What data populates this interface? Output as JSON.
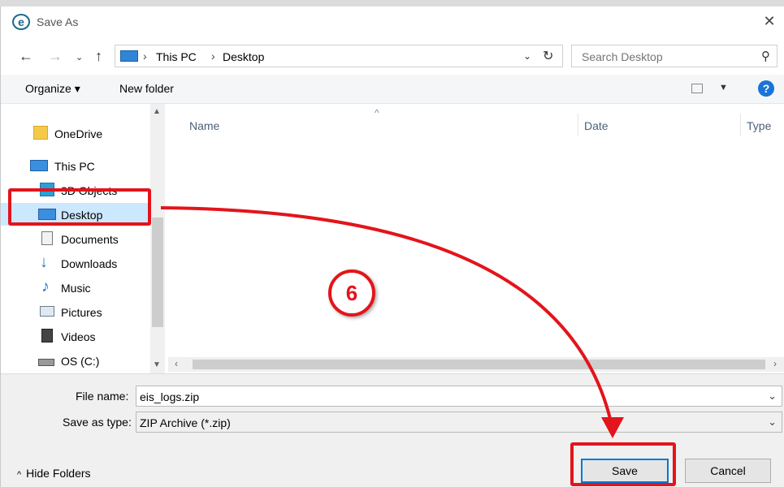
{
  "window": {
    "title": "Save As",
    "app_icon_glyph": "e"
  },
  "address_bar": {
    "crumbs": [
      "This PC",
      "Desktop"
    ],
    "search_placeholder": "Search Desktop"
  },
  "toolbar": {
    "organize": "Organize ▾",
    "new_folder": "New folder"
  },
  "nav_pane": {
    "items": [
      {
        "label": "OneDrive",
        "icon": "folder-icon"
      },
      {
        "label": "This PC",
        "icon": "computer-icon"
      },
      {
        "label": "3D Objects",
        "icon": "cube-icon"
      },
      {
        "label": "Desktop",
        "icon": "desktop-icon"
      },
      {
        "label": "Documents",
        "icon": "document-icon"
      },
      {
        "label": "Downloads",
        "icon": "download-arrow-icon"
      },
      {
        "label": "Music",
        "icon": "music-note-icon"
      },
      {
        "label": "Pictures",
        "icon": "picture-icon"
      },
      {
        "label": "Videos",
        "icon": "film-icon"
      },
      {
        "label": "OS (C:)",
        "icon": "drive-icon"
      }
    ]
  },
  "file_list": {
    "columns": [
      "Name",
      "Date",
      "Type"
    ]
  },
  "bottom": {
    "file_name_label": "File name:",
    "file_name_value": "eis_logs.zip",
    "save_type_label": "Save as type:",
    "save_type_value": "ZIP Archive (*.zip)",
    "hide_folders": "Hide Folders",
    "save_button": "Save",
    "cancel_button": "Cancel"
  },
  "annotation": {
    "step_number": "6",
    "color": "#e3141b"
  },
  "colors": {
    "accent": "#0078d7",
    "help": "#1a73d6",
    "column_header": "#4c607a"
  }
}
